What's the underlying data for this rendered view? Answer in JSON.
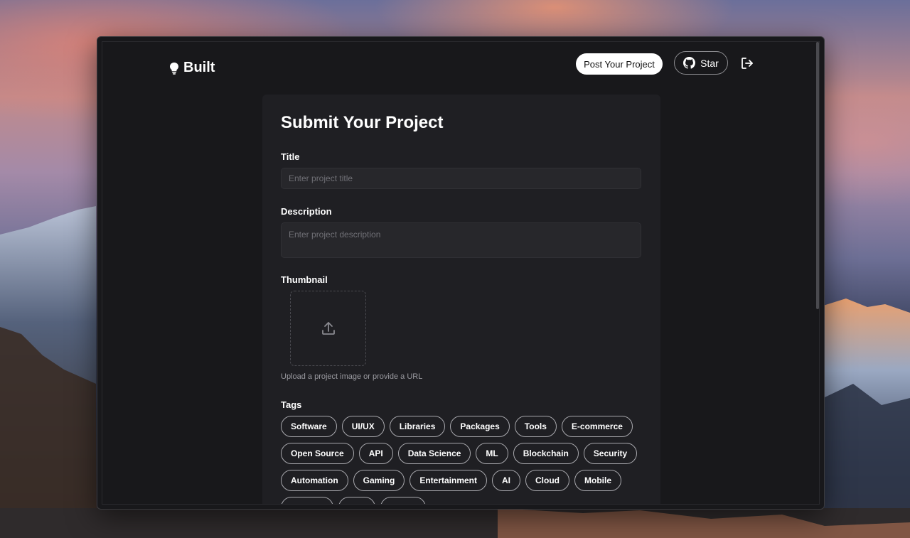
{
  "brand": {
    "name": "Built",
    "icon": "lightbulb-icon"
  },
  "header": {
    "post_label": "Post Your Project",
    "star_label": "Star",
    "star_icon": "github-icon",
    "logout_icon": "logout-icon"
  },
  "form": {
    "title": "Submit Your Project",
    "fields": {
      "title_label": "Title",
      "title_placeholder": "Enter project title",
      "description_label": "Description",
      "description_placeholder": "Enter project description",
      "thumbnail_label": "Thumbnail",
      "thumbnail_icon": "upload-icon",
      "thumbnail_helper": "Upload a project image or provide a URL",
      "tags_label": "Tags"
    },
    "tags": [
      "Software",
      "UI/UX",
      "Libraries",
      "Packages",
      "Tools",
      "E-commerce",
      "Open Source",
      "API",
      "Data Science",
      "ML",
      "Blockchain",
      "Security",
      "Automation",
      "Gaming",
      "Entertainment",
      "AI",
      "Cloud",
      "Mobile",
      "",
      "",
      ""
    ]
  },
  "colors": {
    "window_bg": "#18181b",
    "card_bg": "#1f1f23",
    "input_bg": "#27272b",
    "accent": "#ffffff"
  }
}
